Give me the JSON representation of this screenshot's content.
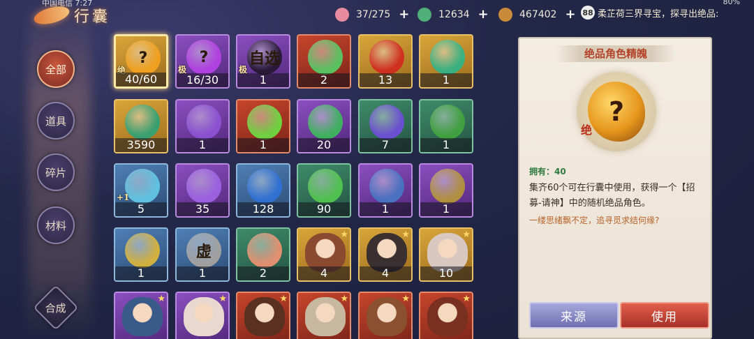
{
  "status": {
    "clock": "中国电信 7:27",
    "battery": "80%"
  },
  "page_title": "行囊",
  "resources": [
    {
      "name": "peach-icon",
      "value": "37/275",
      "color": "#e88aa0"
    },
    {
      "name": "jade-icon",
      "value": "12634",
      "color": "#4fb07a"
    },
    {
      "name": "coin-icon",
      "value": "467402",
      "color": "#c98a3a"
    }
  ],
  "notice": {
    "badge": "88",
    "text": "柔芷荷三界寻宝，探寻出绝品:"
  },
  "tabs": [
    {
      "label": "全部",
      "active": true
    },
    {
      "label": "道具",
      "active": false
    },
    {
      "label": "碎片",
      "active": false
    },
    {
      "label": "材料",
      "active": false
    },
    {
      "label": "合成",
      "active": false
    }
  ],
  "items": [
    {
      "count": "40/60",
      "rarity": "gold",
      "tag": "绝",
      "glyph": "?",
      "hue": "#f0a020",
      "selected": true
    },
    {
      "count": "16/30",
      "rarity": "purple",
      "tag": "极",
      "glyph": "?",
      "hue": "#b040e0"
    },
    {
      "count": "1",
      "rarity": "purple",
      "tag": "极",
      "glyph": "自选",
      "hue": "#2a1a3a"
    },
    {
      "count": "2",
      "rarity": "red",
      "tag": "",
      "glyph": "",
      "hue": "#5ac060"
    },
    {
      "count": "13",
      "rarity": "gold",
      "tag": "",
      "glyph": "",
      "hue": "#d03020"
    },
    {
      "count": "1",
      "rarity": "gold",
      "tag": "",
      "glyph": "",
      "hue": "#3ab080"
    },
    {
      "count": "3590",
      "rarity": "gold",
      "tag": "",
      "glyph": "",
      "hue": "#3aa070"
    },
    {
      "count": "1",
      "rarity": "purple",
      "tag": "",
      "glyph": "",
      "hue": "#8a50d0"
    },
    {
      "count": "1",
      "rarity": "red",
      "tag": "",
      "glyph": "",
      "hue": "#70d040"
    },
    {
      "count": "20",
      "rarity": "purple",
      "tag": "",
      "glyph": "",
      "hue": "#40b060"
    },
    {
      "count": "7",
      "rarity": "green",
      "tag": "",
      "glyph": "",
      "hue": "#6a50d0"
    },
    {
      "count": "1",
      "rarity": "green",
      "tag": "",
      "glyph": "",
      "hue": "#40a040"
    },
    {
      "count": "5",
      "rarity": "blue",
      "tag": "+1",
      "glyph": "",
      "hue": "#60c0e0"
    },
    {
      "count": "35",
      "rarity": "purple",
      "tag": "",
      "glyph": "",
      "hue": "#9a60e0"
    },
    {
      "count": "128",
      "rarity": "blue",
      "tag": "",
      "glyph": "",
      "hue": "#3070d0"
    },
    {
      "count": "90",
      "rarity": "green",
      "tag": "",
      "glyph": "",
      "hue": "#50c050"
    },
    {
      "count": "1",
      "rarity": "purple",
      "tag": "",
      "glyph": "",
      "hue": "#4a70c0"
    },
    {
      "count": "1",
      "rarity": "purple",
      "tag": "",
      "glyph": "",
      "hue": "#b09040"
    },
    {
      "count": "1",
      "rarity": "blue",
      "tag": "",
      "glyph": "",
      "hue": "#d0b040"
    },
    {
      "count": "1",
      "rarity": "blue",
      "tag": "",
      "glyph": "虚",
      "hue": "#a0a0a0"
    },
    {
      "count": "2",
      "rarity": "green",
      "tag": "",
      "glyph": "",
      "hue": "#e09070"
    },
    {
      "count": "4",
      "rarity": "gold",
      "tag": "",
      "glyph": "",
      "hue": "#8a4a30",
      "star": true
    },
    {
      "count": "4",
      "rarity": "gold",
      "tag": "",
      "glyph": "",
      "hue": "#3a3030",
      "star": true
    },
    {
      "count": "10",
      "rarity": "gold",
      "tag": "",
      "glyph": "",
      "hue": "#d8c8c0",
      "star": true
    },
    {
      "count": "",
      "rarity": "purple",
      "tag": "",
      "glyph": "",
      "hue": "#3a5a8a",
      "star": true
    },
    {
      "count": "",
      "rarity": "purple",
      "tag": "",
      "glyph": "",
      "hue": "#e8d8d0",
      "star": true
    },
    {
      "count": "",
      "rarity": "red",
      "tag": "",
      "glyph": "",
      "hue": "#5a3020",
      "star": true
    },
    {
      "count": "",
      "rarity": "red",
      "tag": "",
      "glyph": "",
      "hue": "#c8b8a0",
      "star": true
    },
    {
      "count": "",
      "rarity": "red",
      "tag": "",
      "glyph": "",
      "hue": "#8a5030",
      "star": true
    },
    {
      "count": "",
      "rarity": "red",
      "tag": "",
      "glyph": "",
      "hue": "#7a3020",
      "star": true
    }
  ],
  "detail": {
    "title": "绝品角色精魄",
    "glyph": "?",
    "mark": "绝",
    "owned": "拥有：40",
    "desc": "集齐60个可在行囊中使用，获得一个【招募-请神】中的随机绝品角色。",
    "flavor": "一缕思绪飘不定，追寻觅求结何缘?",
    "source_label": "来源",
    "use_label": "使用"
  }
}
